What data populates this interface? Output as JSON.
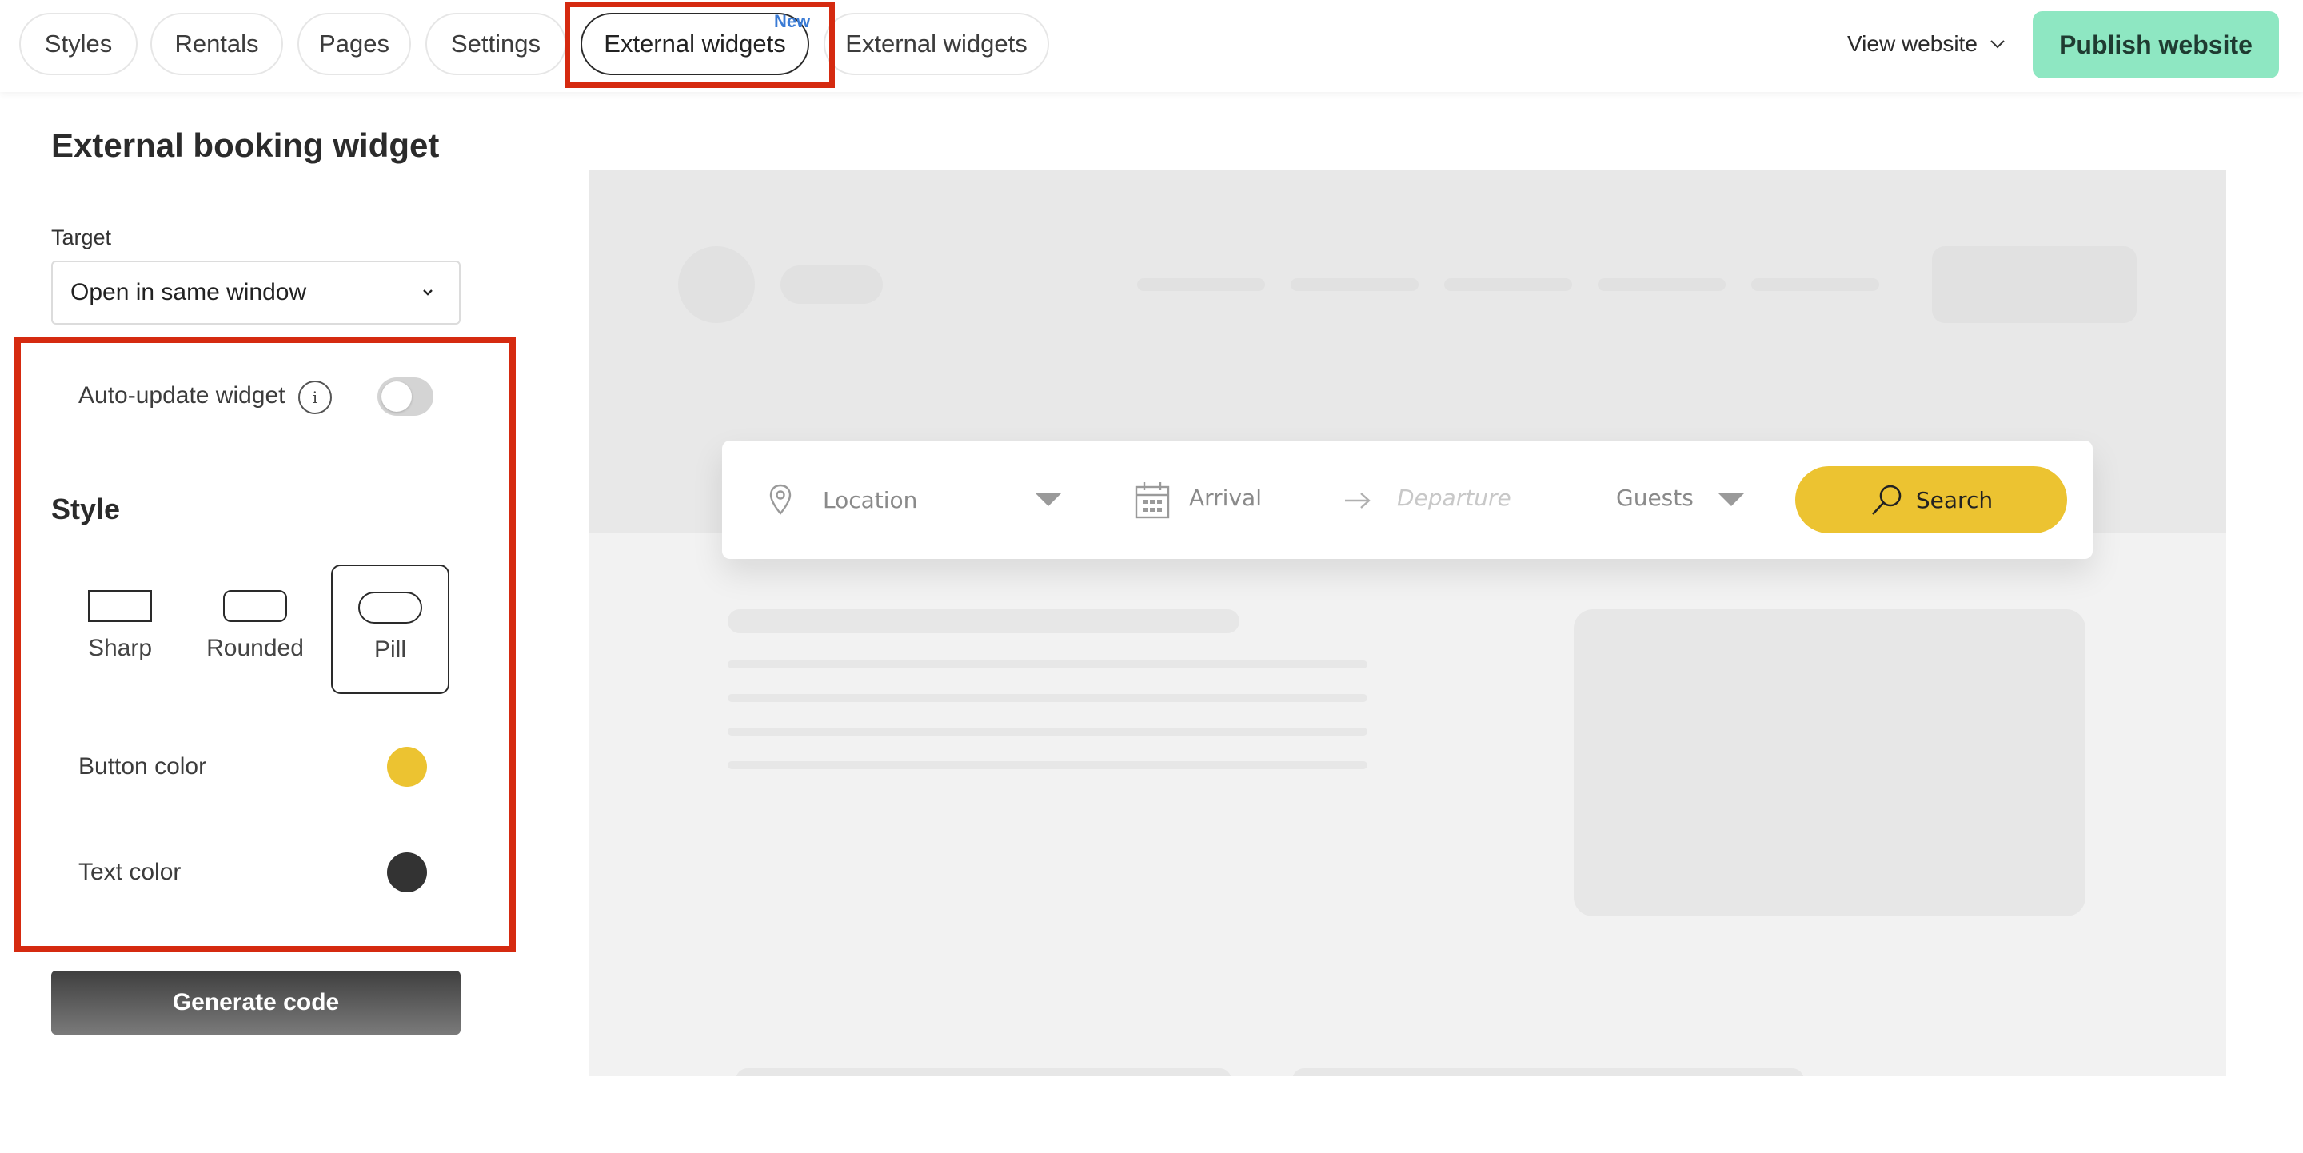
{
  "topbar": {
    "tabs": [
      {
        "label": "Styles"
      },
      {
        "label": "Rentals"
      },
      {
        "label": "Pages"
      },
      {
        "label": "Settings"
      },
      {
        "label": "External widgets",
        "badge": "New"
      },
      {
        "label": "External widgets"
      }
    ],
    "view_website": "View website",
    "publish": "Publish website"
  },
  "panel": {
    "title": "External booking widget",
    "target_label": "Target",
    "target_value": "Open in same window",
    "auto_update_label": "Auto-update widget",
    "auto_update_on": false,
    "style_heading": "Style",
    "style_options": [
      {
        "label": "Sharp"
      },
      {
        "label": "Rounded"
      },
      {
        "label": "Pill"
      }
    ],
    "selected_style": "Pill",
    "button_color_label": "Button color",
    "button_color": "#ECC331",
    "text_color_label": "Text color",
    "text_color": "#333333",
    "generate": "Generate code"
  },
  "widget": {
    "location_placeholder": "Location",
    "arrival_placeholder": "Arrival",
    "departure_placeholder": "Departure",
    "guests_placeholder": "Guests",
    "search_label": "Search"
  },
  "colors": {
    "publish_bg": "#8EE7C2",
    "annotation": "#D52A10",
    "badge": "#3A7BD5"
  }
}
